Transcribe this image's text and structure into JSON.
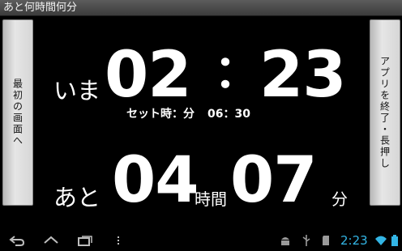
{
  "window": {
    "title": "あと何時間何分"
  },
  "buttons": {
    "back_to_first": "最初の画面へ",
    "exit_long_press": "アプリを終了・長押し"
  },
  "now": {
    "label": "いま",
    "hours": "02",
    "separator": "：",
    "minutes": "23"
  },
  "set_time": {
    "label": "セット時：分",
    "value": "06：30"
  },
  "remaining": {
    "label": "あと",
    "hours": "04",
    "hours_unit": "時間",
    "minutes": "07",
    "minutes_unit": "分"
  },
  "system_bar": {
    "clock": "2:23",
    "icons": [
      "back-icon",
      "home-icon",
      "recent-apps-icon",
      "menu-icon",
      "android-debug-icon",
      "usb-icon",
      "sd-card-icon",
      "wifi-icon",
      "battery-icon"
    ],
    "accent_color": "#33b5e5"
  }
}
